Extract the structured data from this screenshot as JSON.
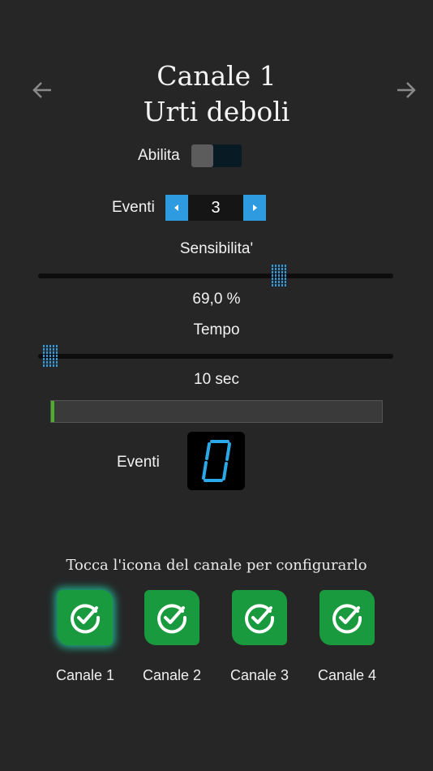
{
  "header": {
    "channel_title": "Canale 1",
    "mode_title": "Urti deboli",
    "prev_icon": "arrow-left-icon",
    "next_icon": "arrow-right-icon"
  },
  "enable": {
    "label": "Abilita",
    "on": false
  },
  "events_stepper": {
    "label": "Eventi",
    "value": "3"
  },
  "sensitivity": {
    "label": "Sensibilita'",
    "value_text": "69,0 %",
    "fraction": 0.69
  },
  "time": {
    "label": "Tempo",
    "value_text": "10 sec",
    "fraction": 0.0
  },
  "progress": {
    "fraction": 0.01
  },
  "event_counter": {
    "label": "Eventi",
    "digit": "0"
  },
  "channels": {
    "instruction": "Tocca l'icona del canale per configurarlo",
    "items": [
      {
        "label": "Canale 1",
        "selected": true
      },
      {
        "label": "Canale 2",
        "selected": false
      },
      {
        "label": "Canale 3",
        "selected": false
      },
      {
        "label": "Canale 4",
        "selected": false
      }
    ]
  },
  "colors": {
    "accent_blue": "#2e9be0",
    "channel_green": "#1a9a3e",
    "progress_green": "#4caf2a",
    "digit_blue": "#2aa8e8"
  }
}
